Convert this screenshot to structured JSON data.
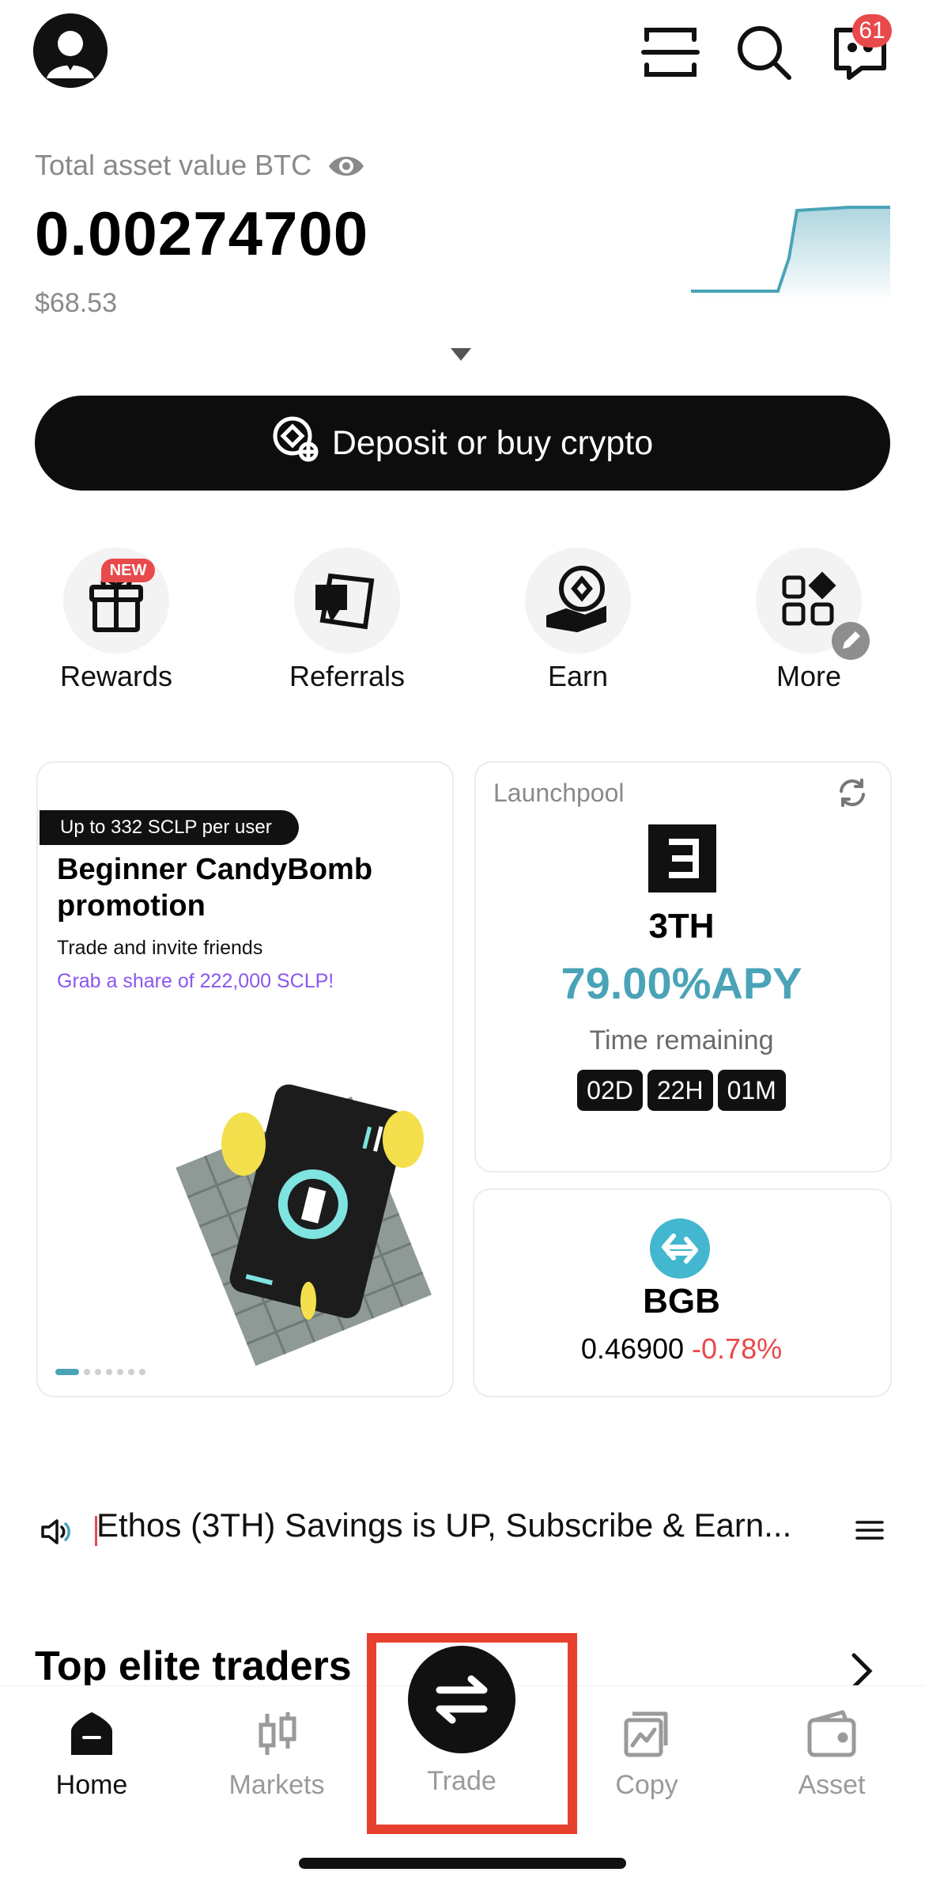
{
  "header": {
    "notification_count": "61",
    "icons": [
      "avatar",
      "scan-icon",
      "search-icon",
      "message-icon"
    ]
  },
  "balance": {
    "label": "Total asset value BTC",
    "btc_value": "0.00274700",
    "usd_value": "$68.53"
  },
  "deposit_button": {
    "label": "Deposit or buy crypto"
  },
  "quick_actions": [
    {
      "label": "Rewards",
      "badge": "NEW"
    },
    {
      "label": "Referrals"
    },
    {
      "label": "Earn"
    },
    {
      "label": "More"
    }
  ],
  "promo": {
    "tag": "Up to 332 SCLP per user",
    "title": "Beginner CandyBomb promotion",
    "subtitle": "Trade and invite friends",
    "highlight": "Grab a share of 222,000 SCLP!",
    "page_total": 7,
    "page_current": 1
  },
  "launchpool": {
    "label": "Launchpool",
    "token": "3TH",
    "apy": "79.00%APY",
    "time_label": "Time remaining",
    "days": "02D",
    "hours": "22H",
    "minutes": "01M"
  },
  "bgb": {
    "name": "BGB",
    "price": "0.46900",
    "change": "-0.78%"
  },
  "news": {
    "text": "Ethos (3TH) Savings is UP, Subscribe & Earn..."
  },
  "elite": {
    "title": "Top elite traders"
  },
  "nav": {
    "home": "Home",
    "markets": "Markets",
    "trade": "Trade",
    "copy": "Copy",
    "asset": "Asset"
  },
  "colors": {
    "accent": "#4aa3b7",
    "negative": "#e8494b",
    "promo_purple": "#8a56f0",
    "highlight_border": "#e8402f"
  }
}
